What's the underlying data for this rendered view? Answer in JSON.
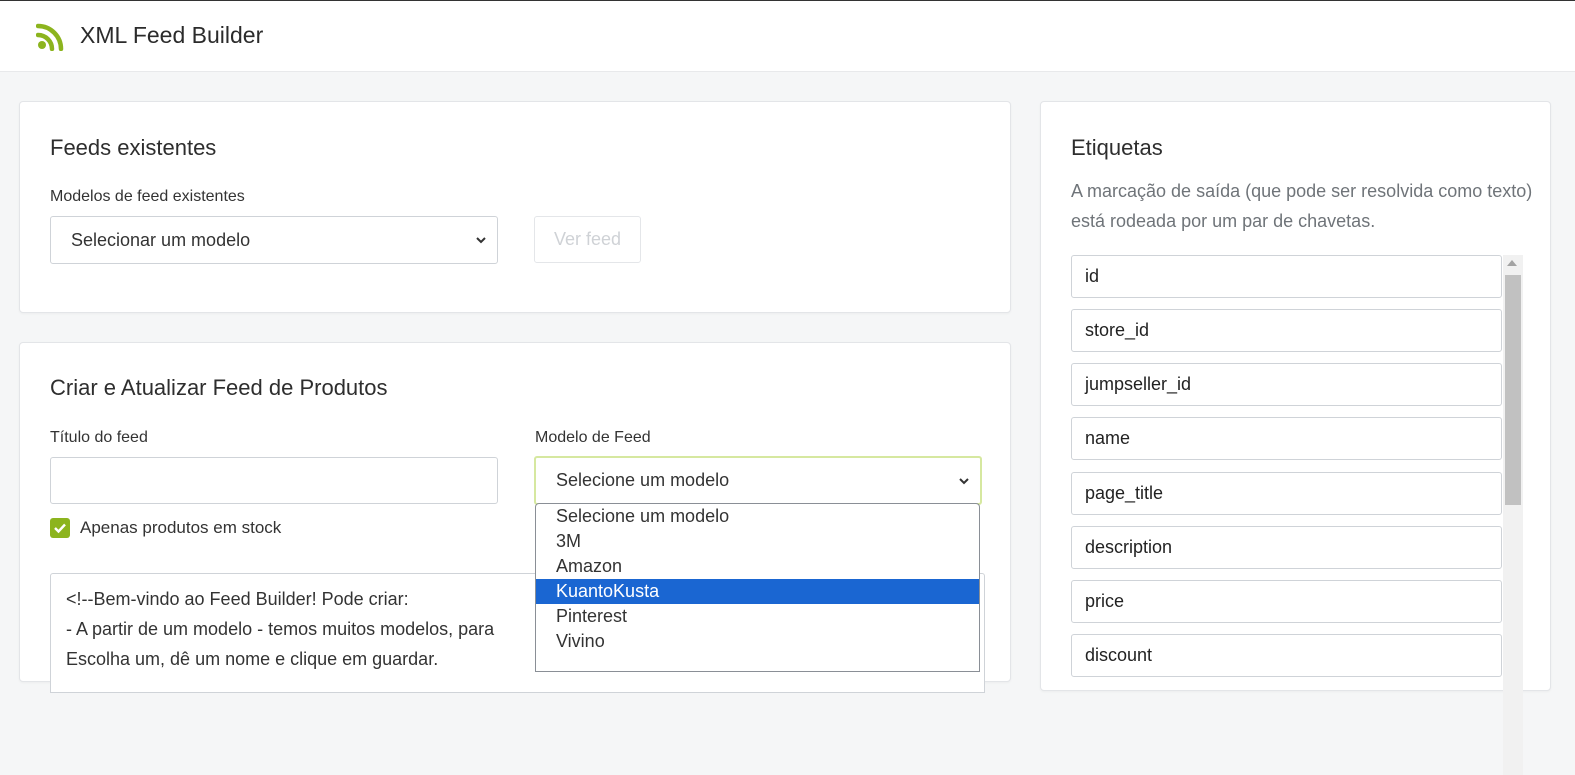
{
  "app": {
    "title": "XML Feed Builder",
    "icon": "rss-icon",
    "accent": "#8cb41e"
  },
  "existing": {
    "heading": "Feeds existentes",
    "models_label": "Modelos de feed existentes",
    "models_select_value": "Selecionar um modelo",
    "view_button": "Ver feed"
  },
  "create": {
    "heading": "Criar e Atualizar Feed de Produtos",
    "title_label": "Título do feed",
    "title_value": "",
    "model_label": "Modelo de Feed",
    "model_select_value": "Selecione um modelo",
    "stock_only_label": "Apenas produtos em stock",
    "stock_only_checked": true,
    "template_lines": [
      "<!--Bem-vindo ao Feed Builder! Pode criar:",
      "- A partir de um modelo - temos muitos modelos, para",
      "Escolha um, dê um nome e clique em guardar."
    ]
  },
  "dropdown": {
    "options": [
      "Selecione um modelo",
      "3M",
      "Amazon",
      "KuantoKusta",
      "Pinterest",
      "Vivino"
    ],
    "highlighted": "KuantoKusta",
    "highlight_color": "#1a66d2"
  },
  "tags": {
    "heading": "Etiquetas",
    "description": "A marcação de saída (que pode ser resolvida como texto) está rodeada por um par de chavetas.",
    "items": [
      "id",
      "store_id",
      "jumpseller_id",
      "name",
      "page_title",
      "description",
      "price",
      "discount"
    ]
  }
}
